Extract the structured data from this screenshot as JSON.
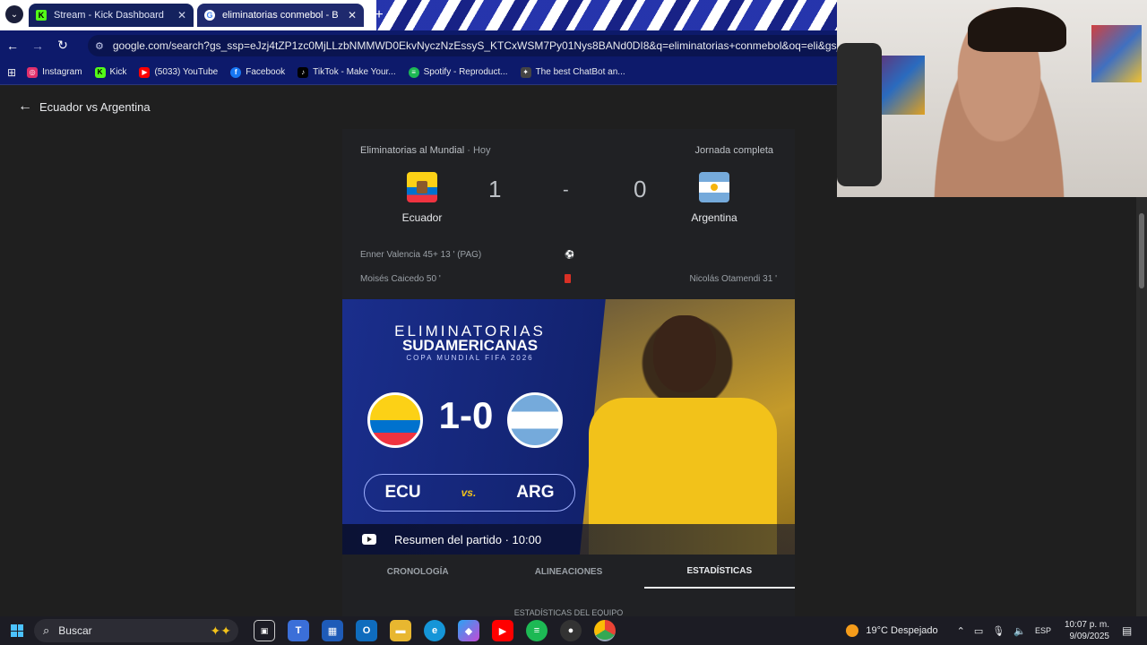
{
  "browser": {
    "tabs": [
      {
        "title": "Stream - Kick Dashboard",
        "favicon": "K"
      },
      {
        "title": "eliminatorias conmebol - Busca",
        "favicon": "G"
      }
    ],
    "new_tab": "+",
    "url": "google.com/search?gs_ssp=eJzj4tZP1zc0MjLLzbNMMWD0EkvNyczNzEssyS_KTCxWSM7Py01Nys8BANd0DI8&q=eliminatorias+conmebol&oq=eli&gs_lcrp=EgZjaHJv",
    "bookmarks": [
      {
        "label": "Instagram",
        "icon": "instagram-icon",
        "color": "#e1306c"
      },
      {
        "label": "Kick",
        "icon": "kick-icon",
        "color": "#53fc18"
      },
      {
        "label": "(5033) YouTube",
        "icon": "youtube-icon",
        "color": "#ff0000"
      },
      {
        "label": "Facebook",
        "icon": "facebook-icon",
        "color": "#1877f2"
      },
      {
        "label": "TikTok - Make Your...",
        "icon": "tiktok-icon",
        "color": "#000000"
      },
      {
        "label": "Spotify - Reproduct...",
        "icon": "spotify-icon",
        "color": "#1db954"
      },
      {
        "label": "The best ChatBot an...",
        "icon": "chatbot-icon",
        "color": "#444444"
      }
    ]
  },
  "page": {
    "back_title": "Ecuador vs Argentina",
    "competition": "Eliminatorias al Mundial",
    "date": "Hoy",
    "status": "Jornada completa",
    "home": {
      "name": "Ecuador",
      "score": "1"
    },
    "away": {
      "name": "Argentina",
      "score": "0"
    },
    "separator": "-",
    "events": {
      "goal": "Enner Valencia  45+ 13 ' (PAG)",
      "home_card": "Moisés Caicedo  50 '",
      "away_card": "Nicolás Otamendi  31 '"
    },
    "hero": {
      "line1": "ELIMINATORIAS",
      "line2": "SUDAMERICANAS",
      "line3": "COPA MUNDIAL FIFA 2026",
      "score": "1-0",
      "home_code": "ECU",
      "vs": "vs.",
      "away_code": "ARG",
      "summary": "Resumen del partido · 10:00"
    },
    "tabs": [
      "CRONOLOGÍA",
      "ALINEACIONES",
      "ESTADÍSTICAS"
    ],
    "stats_peek": "ESTADÍSTICAS DEL EQUIPO"
  },
  "taskbar": {
    "search_placeholder": "Buscar",
    "weather": "19°C  Despejado",
    "lang": "ESP",
    "time": "10:07 p. m.",
    "date": "9/09/2025"
  }
}
